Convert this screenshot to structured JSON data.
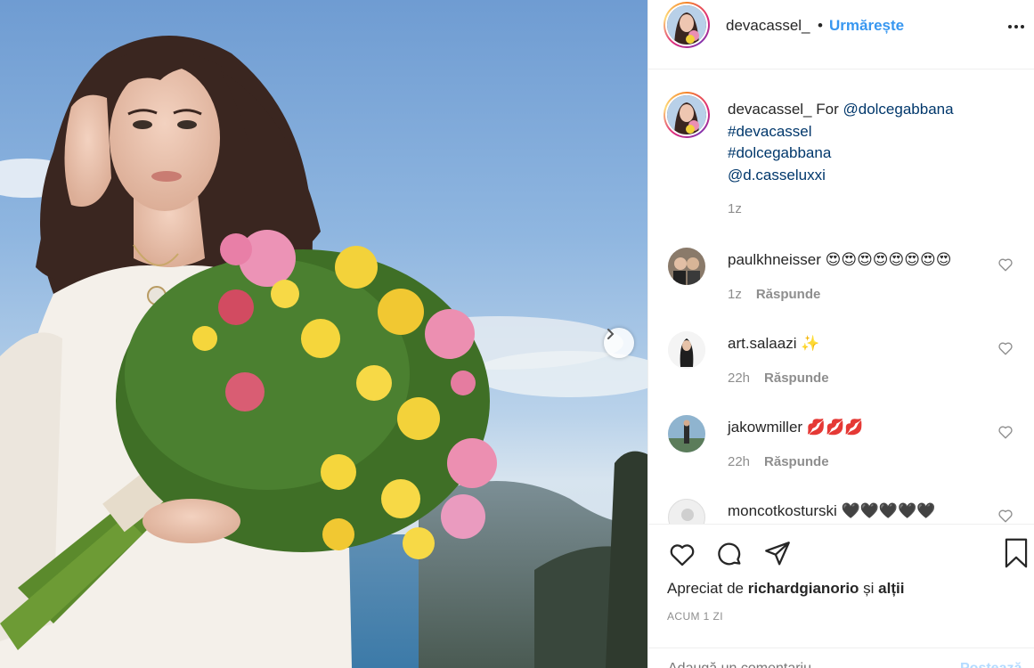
{
  "post": {
    "username": "devacassel_",
    "separator": "•",
    "follow_label": "Urmărește",
    "more_icon": "more-icon",
    "caption": {
      "username": "devacassel_",
      "text_prefix": "For",
      "mention_1": "@dolcegabbana",
      "hashtag_1": "#devacassel",
      "hashtag_2": "#dolcegabbana",
      "mention_2": "@d.casseluxxi",
      "time": "1z"
    },
    "comments": [
      {
        "username": "paulkhneisser",
        "text": "😍😍😍😍😍😍😍😍",
        "time": "1z",
        "reply": "Răspunde"
      },
      {
        "username": "art.salaazi",
        "text": "✨",
        "time": "22h",
        "reply": "Răspunde"
      },
      {
        "username": "jakowmiller",
        "text": "💋💋💋",
        "time": "22h",
        "reply": "Răspunde"
      },
      {
        "username": "moncotkosturski",
        "text": "🖤🖤🖤🖤🖤",
        "time": "",
        "reply": ""
      }
    ],
    "likes": {
      "prefix": "Apreciat de",
      "user": "richardgianorio",
      "suffix": "și",
      "others": "alții"
    },
    "posted_ago": "ACUM 1 ZI",
    "comment_placeholder": "Adaugă un comentariu...",
    "post_label": "Postează"
  },
  "colors": {
    "accent": "#3897f0",
    "link": "#00376b",
    "muted": "#8e8e8e",
    "text": "#262626"
  }
}
